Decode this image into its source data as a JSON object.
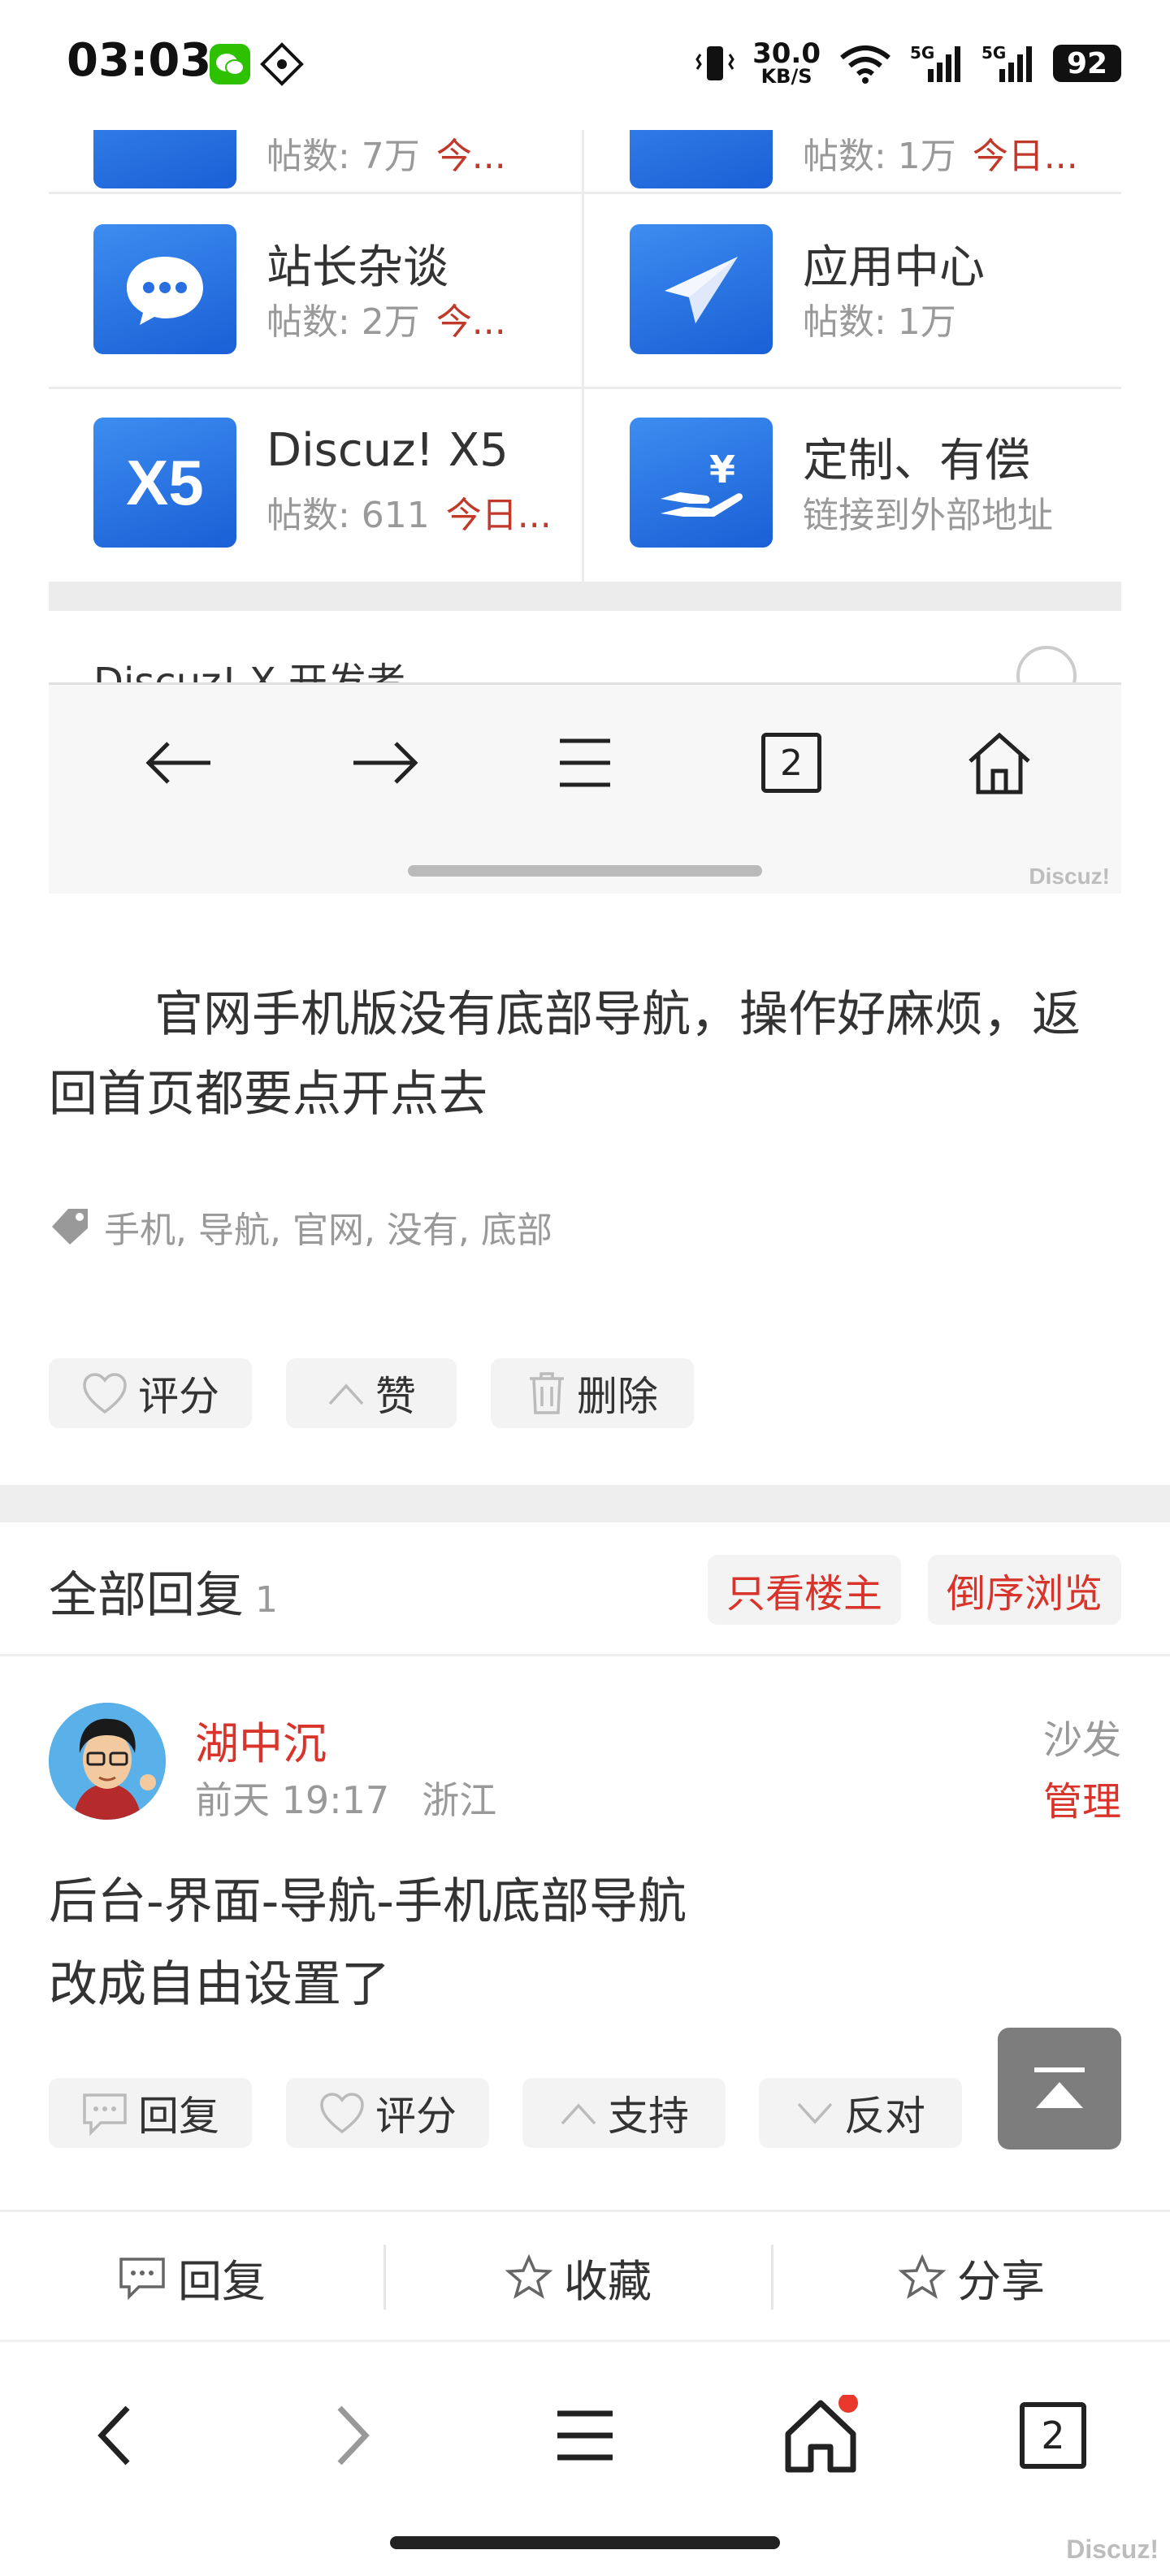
{
  "status_bar": {
    "time": "03:03",
    "speed_value": "30.0",
    "speed_unit": "KB/S",
    "signal1": "5G",
    "signal2": "5G",
    "battery": "92"
  },
  "forums": [
    {
      "title": "站长杂谈",
      "meta": "帖数: 2万",
      "today": "今..."
    },
    {
      "title": "应用中心",
      "meta": "帖数: 1万",
      "today": ""
    },
    {
      "title": "Discuz! X5",
      "meta": "帖数: 611",
      "today": "今日..."
    },
    {
      "title": "定制、有偿",
      "meta": "链接到外部地址",
      "today": ""
    }
  ],
  "forums_cut": [
    {
      "meta": "帖数: 7万",
      "today": "今..."
    },
    {
      "meta": "帖数: 1万",
      "today": "今日..."
    }
  ],
  "embed_section_title": "Discuz! X 开发者",
  "embed_nav": {
    "tab_count": "2"
  },
  "watermark": "Discuz!",
  "post": {
    "text": "官网手机版没有底部导航，操作好麻烦，返回首页都要点开点去",
    "tags": "手机, 导航, 官网, 没有, 底部",
    "btn_rate": "评分",
    "btn_like": "赞",
    "btn_delete": "删除"
  },
  "replies": {
    "title": "全部回复",
    "count": "1",
    "only_op": "只看楼主",
    "reverse": "倒序浏览"
  },
  "reply": {
    "user": "湖中沉",
    "time": "前天 19:17",
    "location": "浙江",
    "floor": "沙发",
    "manage": "管理",
    "line1": "后台-界面-导航-手机底部导航",
    "line2": "改成自由设置了",
    "btn_reply": "回复",
    "btn_rate": "评分",
    "btn_support": "支持",
    "btn_oppose": "反对"
  },
  "action_bar": {
    "reply": "回复",
    "favorite": "收藏",
    "share": "分享"
  },
  "browser_bar": {
    "tab_count": "2"
  },
  "colors": {
    "accent_red": "#d9342b",
    "icon_blue": "#2a6fe0"
  }
}
